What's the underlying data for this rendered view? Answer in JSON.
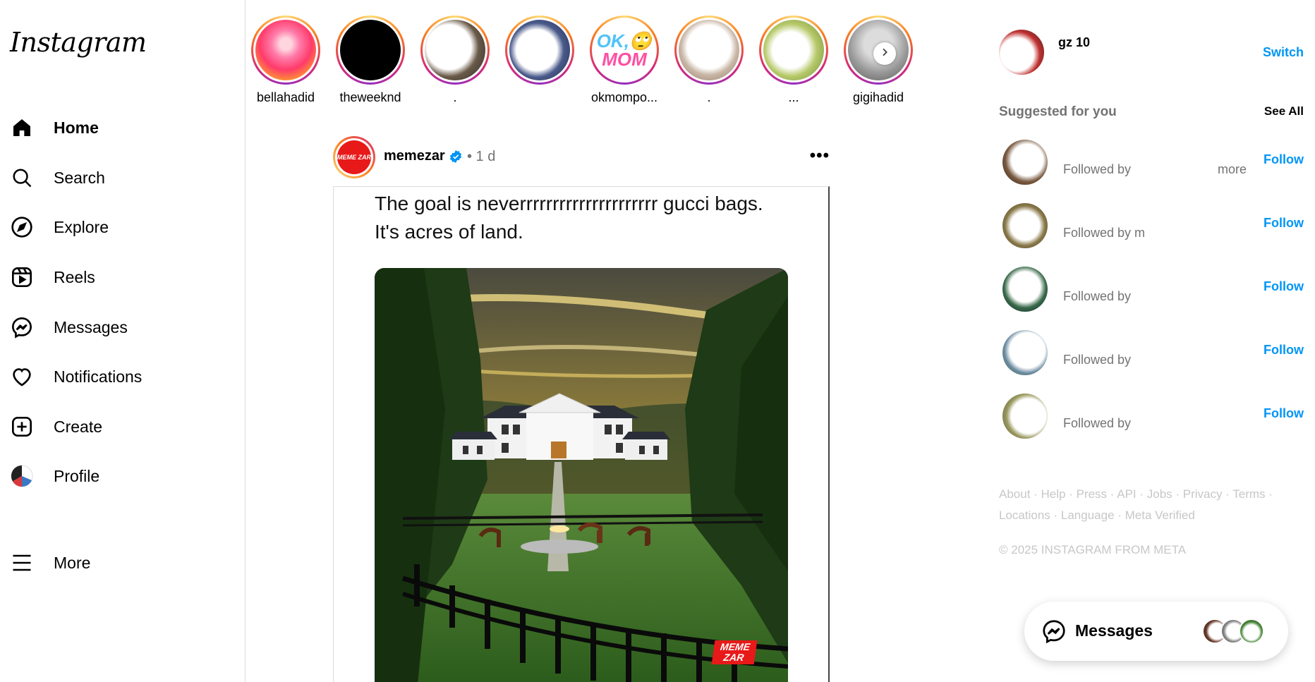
{
  "app": {
    "logo_text": "Instagram"
  },
  "nav": {
    "items": [
      {
        "label": "Home",
        "icon": "home-icon",
        "active": true
      },
      {
        "label": "Search",
        "icon": "search-icon"
      },
      {
        "label": "Explore",
        "icon": "compass-icon"
      },
      {
        "label": "Reels",
        "icon": "reels-icon"
      },
      {
        "label": "Messages",
        "icon": "messenger-icon"
      },
      {
        "label": "Notifications",
        "icon": "heart-icon"
      },
      {
        "label": "Create",
        "icon": "plus-square-icon"
      },
      {
        "label": "Profile",
        "icon": "profile-avatar"
      },
      {
        "label": "More",
        "icon": "hamburger-icon"
      }
    ]
  },
  "stories": [
    {
      "username": "bellahadid"
    },
    {
      "username": "theweeknd"
    },
    {
      "username": "."
    },
    {
      "username": ""
    },
    {
      "username": "okmompo..."
    },
    {
      "username": "."
    },
    {
      "username": "..."
    },
    {
      "username": "gigihadid"
    }
  ],
  "post": {
    "username": "memezar",
    "time": "• 1 d",
    "more": "•••",
    "caption_line1": "The goal is neverrrrrrrrrrrrrrrrrrrrr gucci bags.",
    "caption_line2": "It's acres of land.",
    "avatar_text": "MEME ZAR",
    "watermark": "MEME ZAR"
  },
  "right": {
    "me_username": "gz 10",
    "switch_label": "Switch",
    "suggested_title": "Suggested for you",
    "see_all": "See All",
    "suggestions": [
      {
        "subtitle": "Followed by",
        "extra": "more",
        "follow": "Follow"
      },
      {
        "subtitle": "Followed by m",
        "extra": "",
        "follow": "Follow"
      },
      {
        "subtitle": "Followed by",
        "extra": "",
        "follow": "Follow"
      },
      {
        "subtitle": "Followed by",
        "extra": "",
        "follow": "Follow"
      },
      {
        "subtitle": "Followed by",
        "extra": "",
        "follow": "Follow"
      }
    ],
    "footer_line1": "About · Help · Press · API · Jobs · Privacy · Terms ·",
    "footer_line2": "Locations · Language · Meta Verified",
    "copyright": "© 2025 INSTAGRAM FROM META"
  },
  "messages_pill": {
    "label": "Messages"
  },
  "colors": {
    "accent": "#0095f6",
    "verified": "#0095f6",
    "border": "#dbdbdb"
  }
}
